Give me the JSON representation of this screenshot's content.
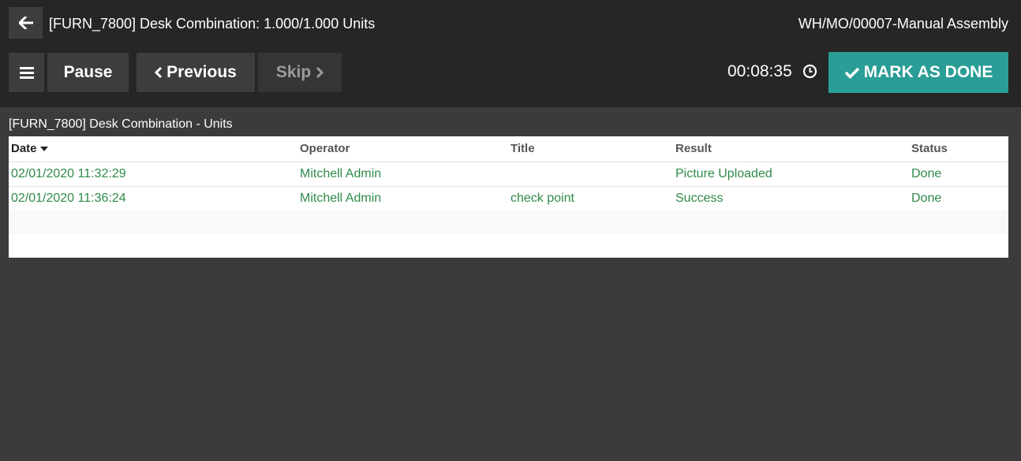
{
  "header": {
    "workorder_title": "[FURN_7800] Desk Combination: 1.000/1.000 Units",
    "mo_name": "WH/MO/00007-Manual Assembly",
    "back_icon": "arrow-left-icon"
  },
  "toolbar": {
    "menu_icon": "hamburger-menu-icon",
    "pause_label": "Pause",
    "previous_label": "Previous",
    "skip_label": "Skip",
    "timer": "00:08:35",
    "clock_icon": "clock-icon",
    "done_label": "MARK AS DONE",
    "done_color": "#2a9d96"
  },
  "section": {
    "title": "[FURN_7800] Desk Combination -  Units"
  },
  "table": {
    "columns": [
      "Date",
      "Operator",
      "Title",
      "Result",
      "Status"
    ],
    "rows": [
      {
        "date": "02/01/2020 11:32:29",
        "operator": "Mitchell Admin",
        "title": "",
        "result": "Picture Uploaded",
        "status": "Done"
      },
      {
        "date": "02/01/2020 11:36:24",
        "operator": "Mitchell Admin",
        "title": "check point",
        "result": "Success",
        "status": "Done"
      }
    ],
    "text_color": "#2f8a4a"
  }
}
